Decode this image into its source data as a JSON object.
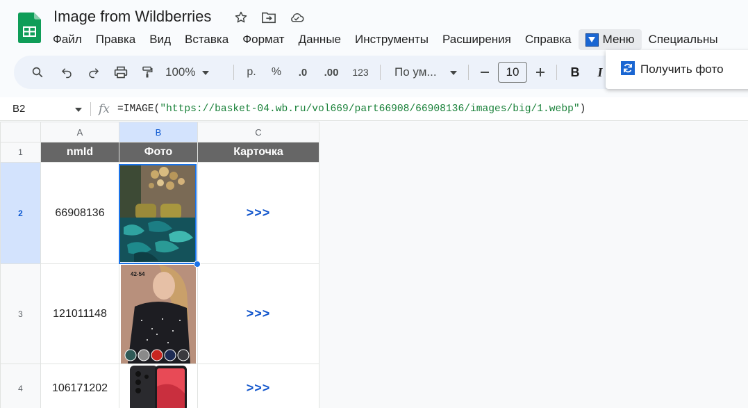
{
  "document": {
    "title": "Image from Wildberries"
  },
  "menu": {
    "items": [
      "Файл",
      "Правка",
      "Вид",
      "Вставка",
      "Формат",
      "Данные",
      "Инструменты",
      "Расширения",
      "Справка"
    ],
    "custom_menu_label": "Меню",
    "last_item": "Специальны"
  },
  "toolbar": {
    "zoom": "100%",
    "currency": "р.",
    "percent": "%",
    "decrease_decimals": ".0",
    "increase_decimals": ".00",
    "more_formats": "123",
    "font": "По ум...",
    "font_size": "10",
    "bold": "B",
    "italic": "I"
  },
  "dropdown": {
    "item_label": "Получить фото"
  },
  "formula_bar": {
    "cell_ref": "B2",
    "fx": "fx",
    "formula_prefix": "=IMAGE(",
    "formula_string": "\"https://basket-04.wb.ru/vol669/part66908/66908136/images/big/1.webp\"",
    "formula_suffix": ")"
  },
  "sheet": {
    "columns": [
      "A",
      "B",
      "C"
    ],
    "header_row": {
      "row_num": "1",
      "cells": [
        "nmId",
        "Фото",
        "Карточка"
      ]
    },
    "rows": [
      {
        "row_num": "2",
        "nmId": "66908136",
        "link": ">>>"
      },
      {
        "row_num": "3",
        "nmId": "121011148",
        "link": ">>>"
      },
      {
        "row_num": "4",
        "nmId": "106171202",
        "link": ">>>"
      }
    ],
    "product_badge_size": "42-54"
  },
  "colors": {
    "accent": "#1a73e8",
    "header_fill": "#666666",
    "link": "#1155cc",
    "sheets_green": "#0f9d58"
  }
}
